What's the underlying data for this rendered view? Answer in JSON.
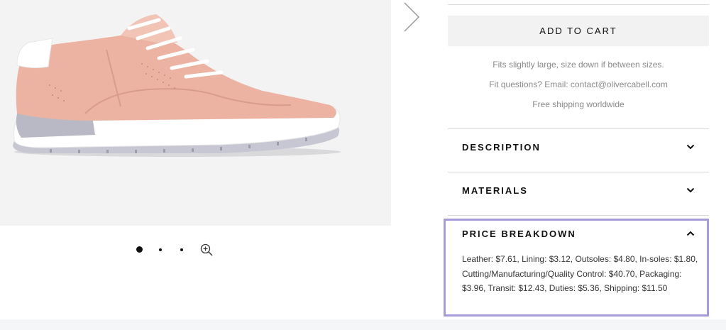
{
  "gallery": {
    "image_alt": "Pink leather sneaker",
    "next_arrow_icon": "chevron-right-icon",
    "zoom_icon": "zoom-in-icon",
    "dots": 3,
    "active_dot": 1
  },
  "product": {
    "add_to_cart_label": "ADD TO CART",
    "fit_note": "Fits slightly large, size down if between sizes.",
    "fit_questions_prefix": "Fit questions? Email: ",
    "contact_email": "contact@olivercabell.com",
    "shipping_note": "Free shipping worldwide"
  },
  "accordion": [
    {
      "title": "DESCRIPTION",
      "expanded": false
    },
    {
      "title": "MATERIALS",
      "expanded": false
    },
    {
      "title": "PRICE BREAKDOWN",
      "expanded": true,
      "content": "Leather: $7.61, Lining: $3.12, Outsoles: $4.80, In-soles: $1.80, Cutting/Manufacturing/Quality Control: $40.70, Packaging: $3.96, Transit: $12.43, Duties: $5.36, Shipping: $11.50"
    }
  ],
  "colors": {
    "highlight": "#a79ad9",
    "shoe_upper": "#ecb3a2",
    "sole": "#ffffff",
    "sole_accent": "#c9c9d6"
  }
}
